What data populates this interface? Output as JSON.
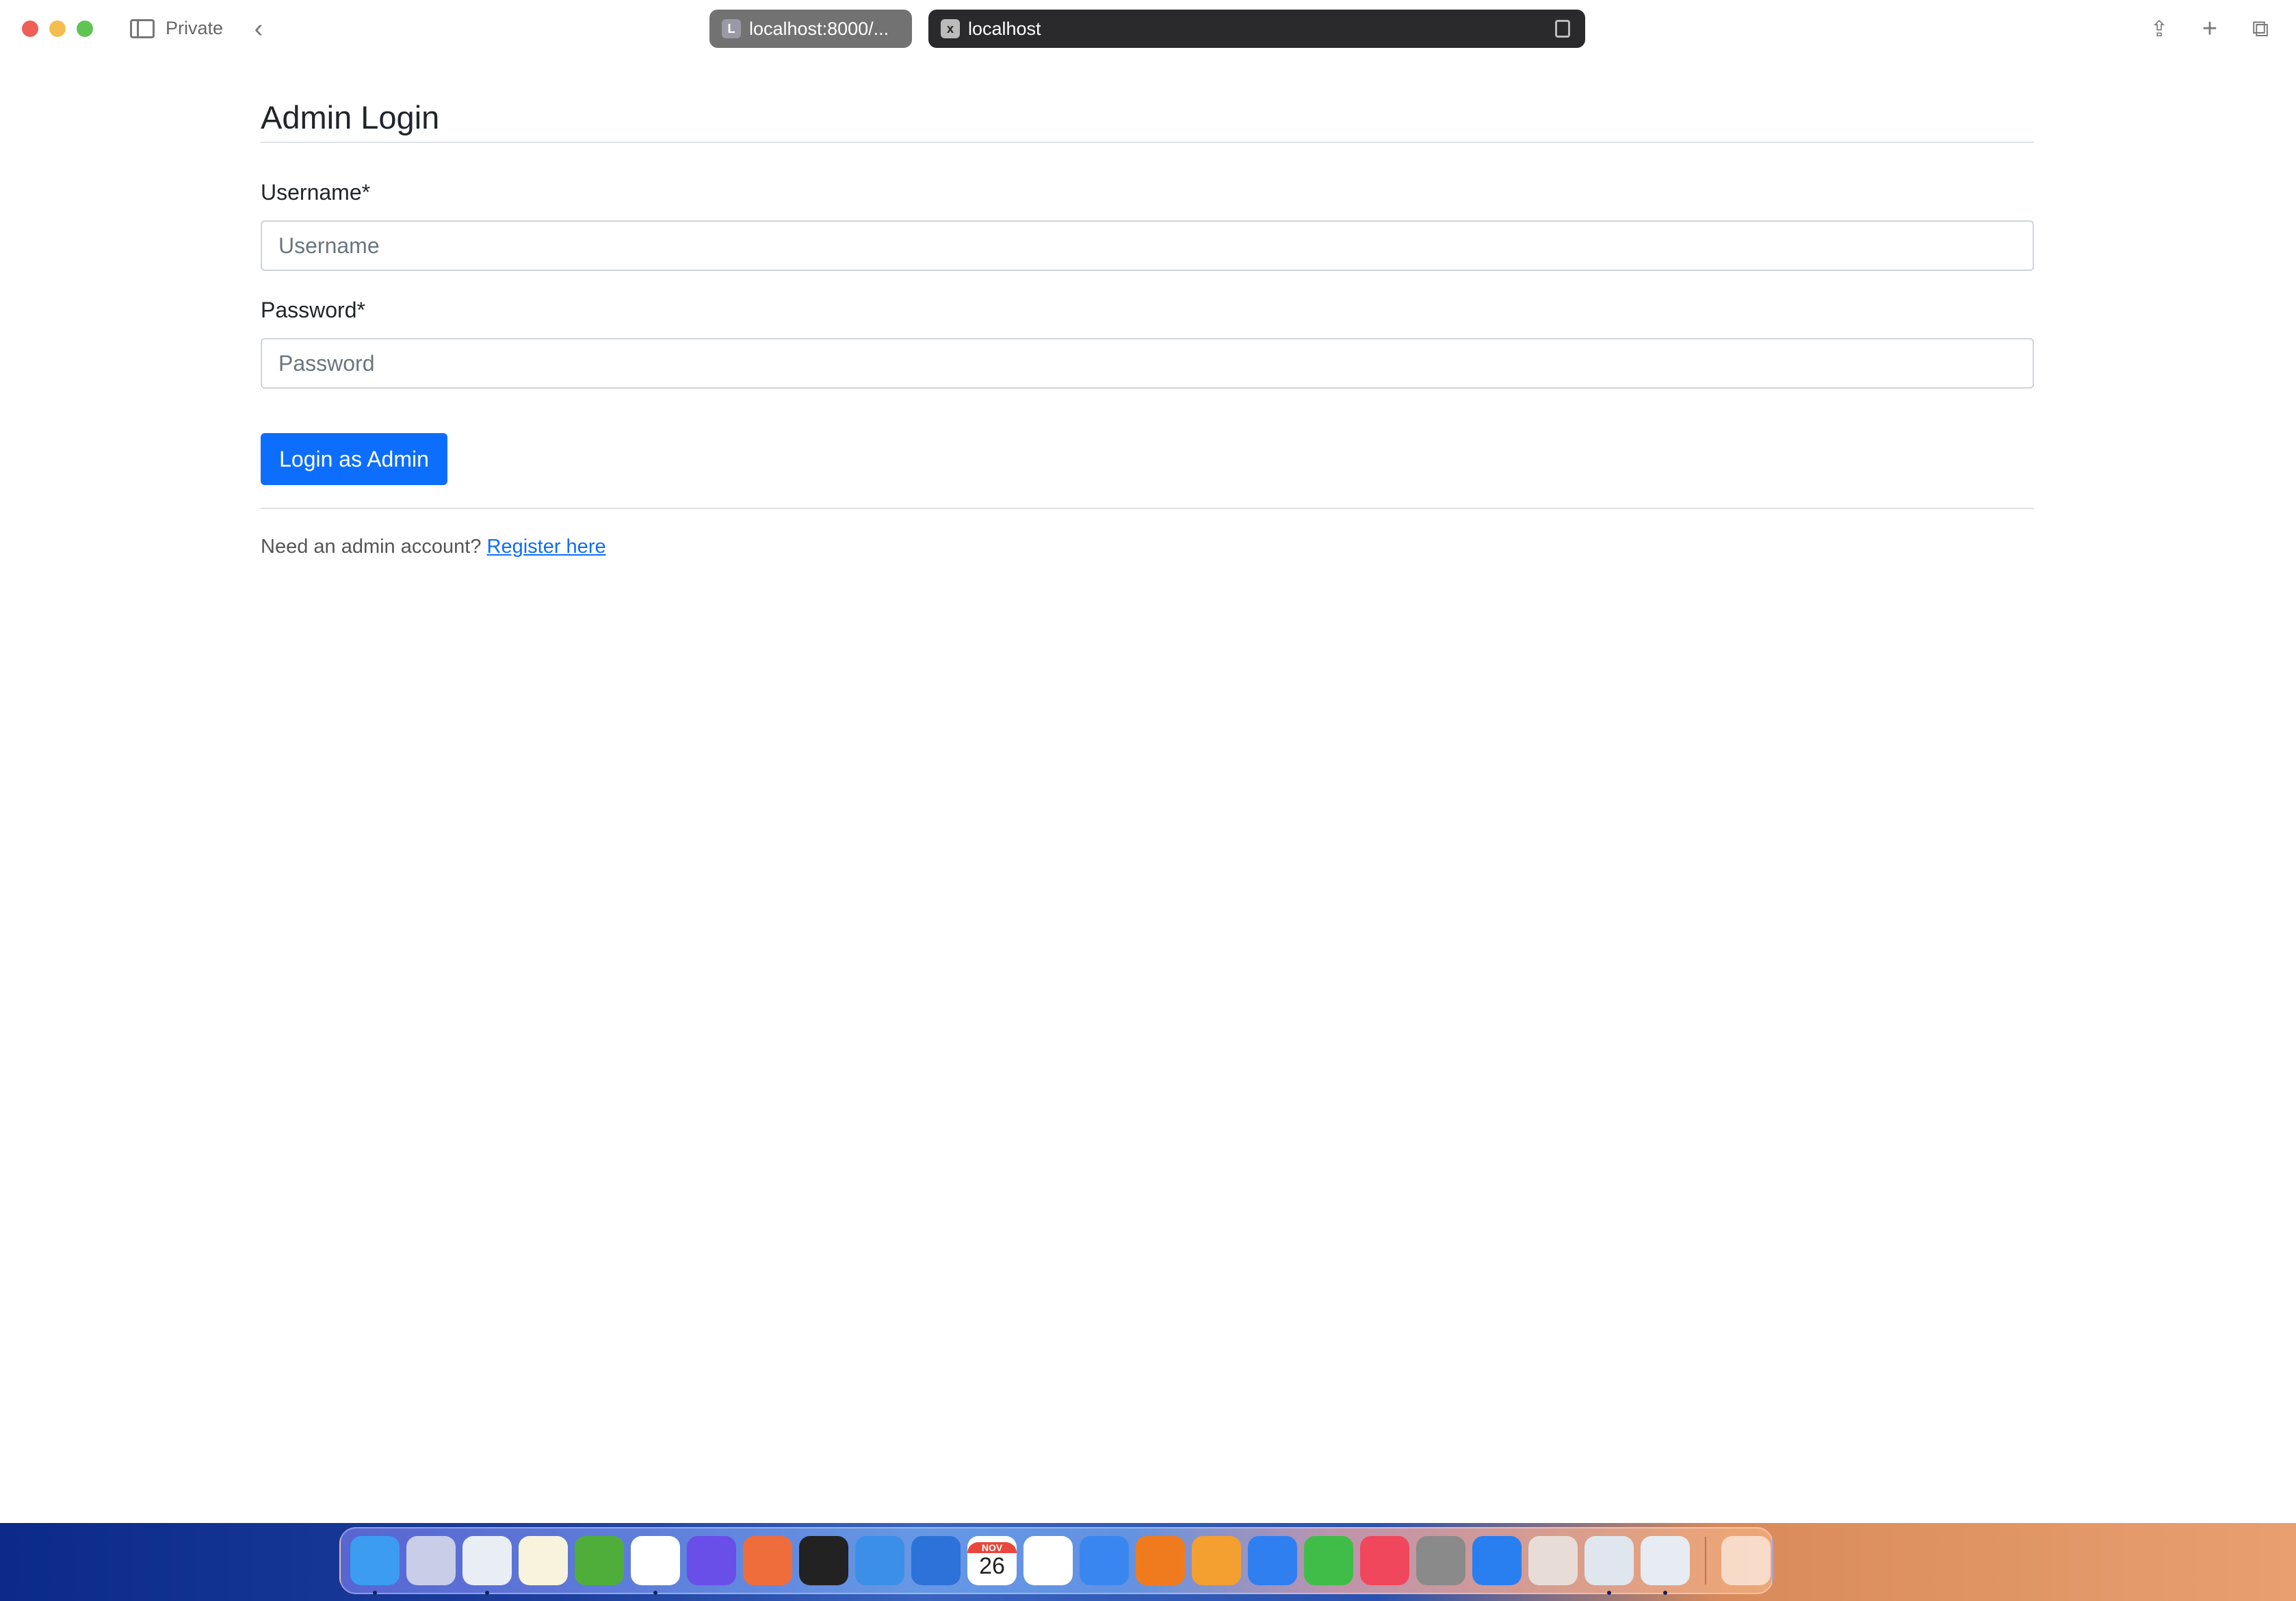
{
  "browser": {
    "private_label": "Private",
    "tabs": [
      {
        "favicon": "L",
        "title": "localhost:8000/...",
        "active": false
      },
      {
        "favicon": "x",
        "title": "localhost",
        "active": true
      }
    ]
  },
  "page": {
    "title": "Admin Login",
    "username_label": "Username*",
    "username_placeholder": "Username",
    "username_value": "",
    "password_label": "Password*",
    "password_placeholder": "Password",
    "password_value": "",
    "submit_label": "Login as Admin",
    "register_prompt": "Need an admin account?",
    "register_link": "Register here",
    "accent_color": "#0d6efd"
  },
  "dock": {
    "calendar_month": "NOV",
    "calendar_day": "26",
    "apps": [
      {
        "name": "finder",
        "color": "#3b9cf0",
        "running": true
      },
      {
        "name": "launchpad",
        "color": "#c8cde8",
        "running": false
      },
      {
        "name": "safari",
        "color": "#e9eef5",
        "running": true
      },
      {
        "name": "notes",
        "color": "#f7f3dc",
        "running": false
      },
      {
        "name": "activity-ring",
        "color": "#4fae3a",
        "running": false
      },
      {
        "name": "vscode",
        "color": "#ffffff",
        "running": true
      },
      {
        "name": "goland",
        "color": "#6a4ee8",
        "running": false
      },
      {
        "name": "postman",
        "color": "#ef6c3b",
        "running": false
      },
      {
        "name": "terminal",
        "color": "#222222",
        "running": false
      },
      {
        "name": "docker",
        "color": "#3b8fe6",
        "running": false
      },
      {
        "name": "xcode",
        "color": "#2d72d9",
        "running": false
      },
      {
        "name": "calendar",
        "color": "#ffffff",
        "running": false
      },
      {
        "name": "reminders",
        "color": "#ffffff",
        "running": false
      },
      {
        "name": "mail",
        "color": "#3a86f0",
        "running": false
      },
      {
        "name": "books",
        "color": "#f07b1f",
        "running": false
      },
      {
        "name": "pages",
        "color": "#f3a030",
        "running": false
      },
      {
        "name": "keynote",
        "color": "#2f7ff0",
        "running": false
      },
      {
        "name": "numbers",
        "color": "#3fbd48",
        "running": false
      },
      {
        "name": "music",
        "color": "#f0475c",
        "running": false
      },
      {
        "name": "system-settings",
        "color": "#8a8a8a",
        "running": false
      },
      {
        "name": "app-store",
        "color": "#2a7ff0",
        "running": false
      },
      {
        "name": "iphone-mirroring",
        "color": "#e8ddd6",
        "running": false
      },
      {
        "name": "postgres",
        "color": "#dfe6ee",
        "running": true
      },
      {
        "name": "preview",
        "color": "#e6ecf2",
        "running": true
      }
    ]
  }
}
